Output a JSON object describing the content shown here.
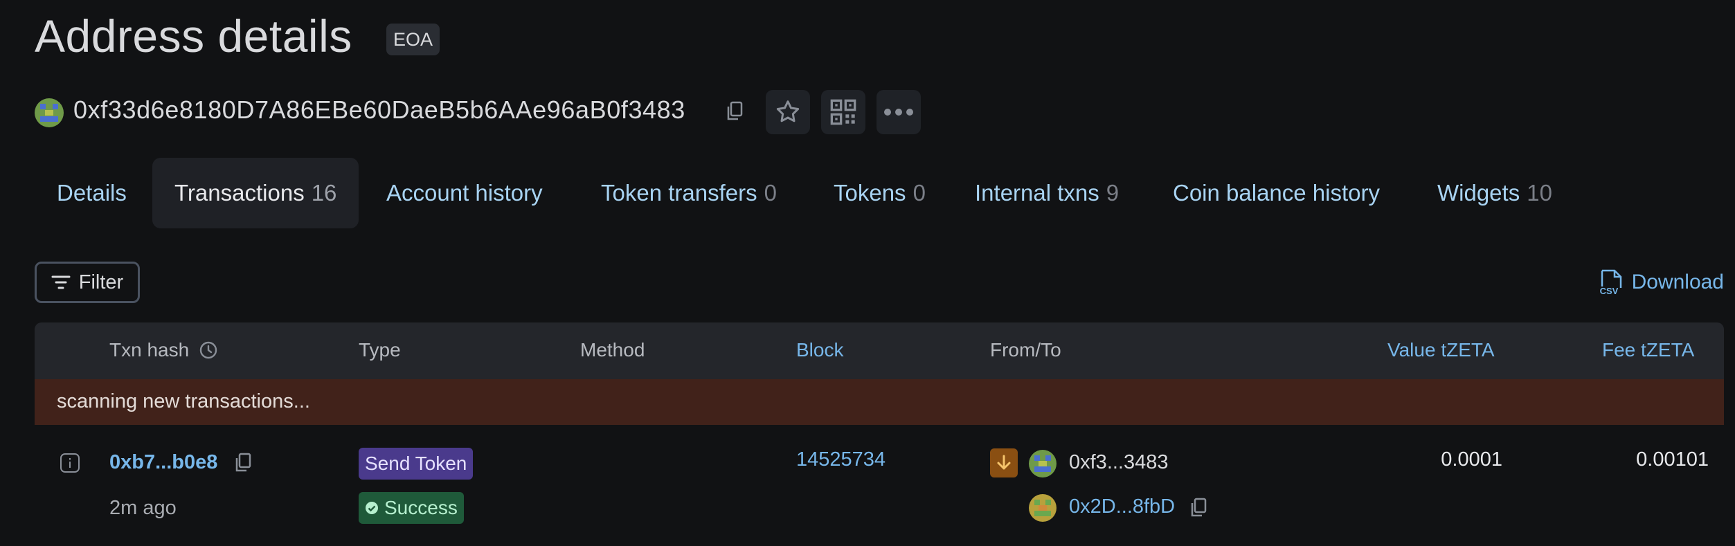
{
  "header": {
    "title": "Address details",
    "badge": "EOA"
  },
  "address": {
    "full": "0xf33d6e8180D7A86EBe60DaeB5b6AAe96aB0f3483"
  },
  "tabs": [
    {
      "label": "Details",
      "count": ""
    },
    {
      "label": "Transactions",
      "count": "16"
    },
    {
      "label": "Account history",
      "count": ""
    },
    {
      "label": "Token transfers",
      "count": "0"
    },
    {
      "label": "Tokens",
      "count": "0"
    },
    {
      "label": "Internal txns",
      "count": "9"
    },
    {
      "label": "Coin balance history",
      "count": ""
    },
    {
      "label": "Widgets",
      "count": "10"
    }
  ],
  "active_tab": "Transactions",
  "toolbar": {
    "filter_label": "Filter",
    "download_label": "Download",
    "csv_label": "CSV"
  },
  "table": {
    "headers": {
      "txn_hash": "Txn hash",
      "type": "Type",
      "method": "Method",
      "block": "Block",
      "from_to": "From/To",
      "value": "Value tZETA",
      "fee": "Fee tZETA"
    },
    "scanning_text": "scanning new transactions...",
    "rows": [
      {
        "hash": "0xb7...b0e8",
        "age": "2m ago",
        "type": "Send Token",
        "status": "Success",
        "method": "",
        "block": "14525734",
        "from": "0xf3...3483",
        "to": "0x2D...8fbD",
        "value": "0.0001",
        "fee": "0.00101"
      }
    ]
  },
  "colors": {
    "background": "#111214",
    "link": "#77b7ea",
    "scan_banner": "#41221a",
    "type_badge": "#4a3a8c",
    "success_badge": "#1f5a3a",
    "direction_icon": "#8a4f12"
  }
}
